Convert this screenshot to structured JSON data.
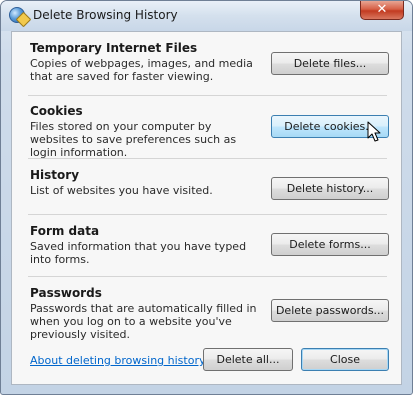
{
  "window": {
    "title": "Delete Browsing History",
    "close_symbol": "✕"
  },
  "sections": [
    {
      "title": "Temporary Internet Files",
      "description": "Copies of webpages, images, and media that are saved for faster viewing.",
      "button": "Delete files..."
    },
    {
      "title": "Cookies",
      "description": "Files stored on your computer by websites to save preferences such as login information.",
      "button": "Delete cookies..."
    },
    {
      "title": "History",
      "description": "List of websites you have visited.",
      "button": "Delete history..."
    },
    {
      "title": "Form data",
      "description": "Saved information that you have typed into forms.",
      "button": "Delete forms..."
    },
    {
      "title": "Passwords",
      "description": "Passwords that are automatically filled in when you log on to a website you've previously visited.",
      "button": "Delete passwords..."
    }
  ],
  "footer": {
    "link": "About deleting browsing history",
    "delete_all": "Delete all...",
    "close": "Close"
  }
}
